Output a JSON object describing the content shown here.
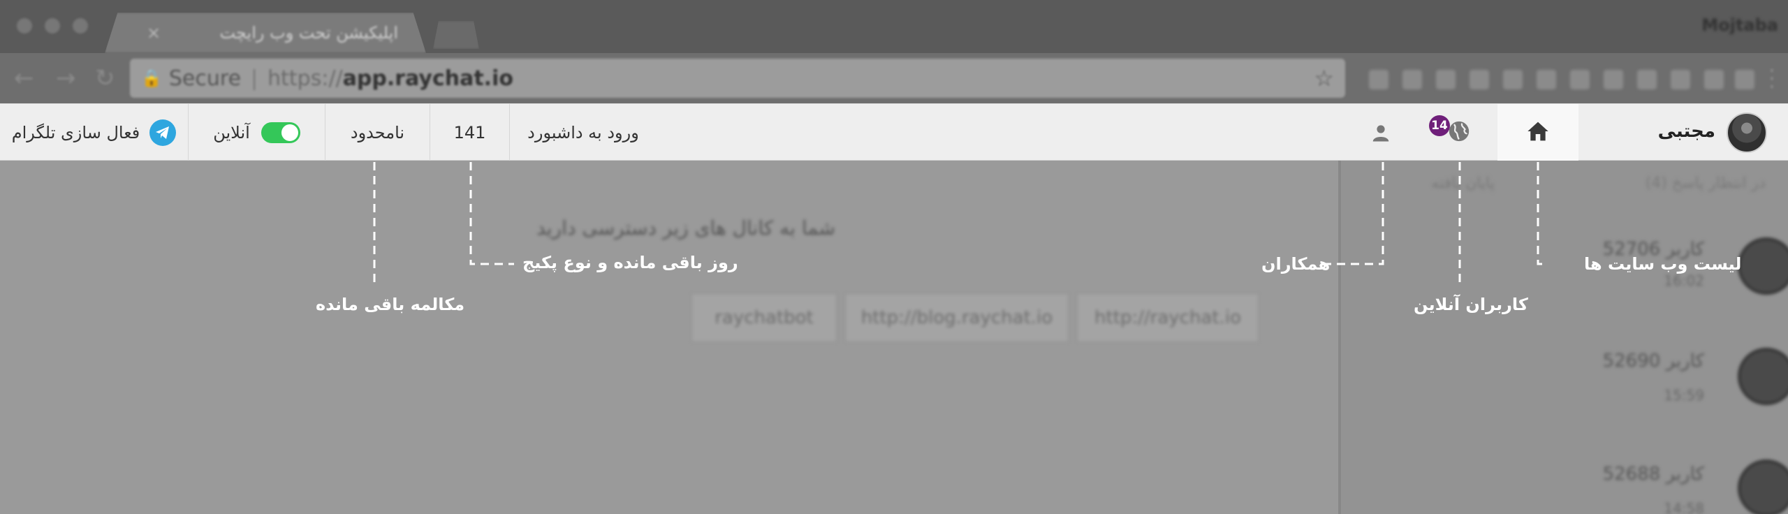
{
  "browser": {
    "tab_title": "اپلیکیشن تحت وب رایچت",
    "tab_close": "×",
    "profile_name": "Mojtaba",
    "address": {
      "secure_label": "Secure",
      "scheme": "https://",
      "host": "app.raychat.io"
    }
  },
  "header": {
    "user_name": "مجتبی",
    "online_badge_count": "14",
    "dashboard_link": "ورود به داشبورد",
    "days_remaining": "141",
    "conversations_remaining": "نامحدود",
    "online_status_label": "آنلاین",
    "telegram_label": "فعال سازی تلگرام",
    "online_toggle_on": true
  },
  "main": {
    "access_text": "شما به کانال های زیر دسترسی دارید",
    "channels": [
      "http://raychat.io",
      "http://blog.raychat.io",
      "raychatbot"
    ]
  },
  "sidebar": {
    "tab_waiting": "در انتظار پاسخ (4)",
    "tab_finished": "پایان یافته",
    "conversations": [
      {
        "name": "کاربر 52706",
        "time": "16:02"
      },
      {
        "name": "کاربر 52690",
        "time": "15:59"
      },
      {
        "name": "کاربر 52688",
        "time": "14:58"
      }
    ]
  },
  "annotations": {
    "websites_list": "لیست وب سایت ها",
    "online_users": "کاربران آنلاین",
    "colleagues": "همکاران",
    "days_and_package": "روز باقی مانده و نوع پکیج",
    "remaining_conversations": "مکالمه باقی مانده"
  },
  "icons": {
    "home": "home-icon",
    "globe": "globe-icon",
    "person": "person-icon",
    "telegram": "telegram-icon",
    "lock": "lock-icon",
    "star": "star-icon"
  },
  "colors": {
    "toggle_on": "#34c759",
    "telegram": "#2ea6df",
    "badge": "#6f1f7a",
    "annotation": "#ffffff"
  }
}
